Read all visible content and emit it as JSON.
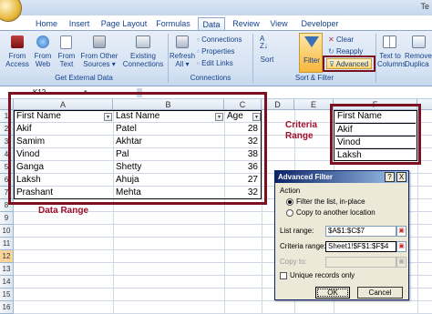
{
  "window": {
    "title": "Te"
  },
  "tabs": [
    "Home",
    "Insert",
    "Page Layout",
    "Formulas",
    "Data",
    "Review",
    "View",
    "Developer"
  ],
  "active_tab": "Data",
  "ribbon": {
    "get_external": {
      "buttons": [
        {
          "l1": "From",
          "l2": "Access"
        },
        {
          "l1": "From",
          "l2": "Web"
        },
        {
          "l1": "From",
          "l2": "Text"
        },
        {
          "l1": "From Other",
          "l2": "Sources ▾"
        },
        {
          "l1": "Existing",
          "l2": "Connections"
        }
      ],
      "label": "Get External Data"
    },
    "connections": {
      "refresh": {
        "l1": "Refresh",
        "l2": "All ▾"
      },
      "items": [
        "Connections",
        "Properties",
        "Edit Links"
      ],
      "label": "Connections"
    },
    "sort_filter": {
      "sort": "Sort",
      "filter": "Filter",
      "items": [
        "Clear",
        "Reapply",
        "Advanced"
      ],
      "label": "Sort & Filter"
    },
    "data_tools": {
      "text_to_columns": {
        "l1": "Text to",
        "l2": "Columns"
      },
      "remove_dup": {
        "l1": "Remove",
        "l2": "Duplica"
      }
    }
  },
  "name_box": "K12",
  "columns": [
    "A",
    "B",
    "C",
    "D",
    "E",
    "F"
  ],
  "rows": [
    "1",
    "2",
    "3",
    "4",
    "5",
    "6",
    "7",
    "8",
    "9",
    "10",
    "11",
    "12",
    "13",
    "14",
    "15",
    "16"
  ],
  "data_range": {
    "headers": [
      "First Name",
      "Last Name",
      "Age"
    ],
    "rows": [
      [
        "Akif",
        "Patel",
        "28"
      ],
      [
        "Samim",
        "Akhtar",
        "32"
      ],
      [
        "Vinod",
        "Pal",
        "38"
      ],
      [
        "Ganga",
        "Shetty",
        "36"
      ],
      [
        "Laksh",
        "Ahuja",
        "27"
      ],
      [
        "Prashant",
        "Mehta",
        "32"
      ]
    ],
    "label": "Data Range"
  },
  "criteria_range": {
    "label_line1": "Criteria",
    "label_line2": "Range",
    "header": "First Name",
    "values": [
      "Akif",
      "Vinod",
      "Laksh"
    ]
  },
  "dialog": {
    "title": "Advanced Filter",
    "help": "?",
    "close": "X",
    "action_label": "Action",
    "option1": "Filter the list, in-place",
    "option2": "Copy to another location",
    "selected_option": "option1",
    "list_range_label": "List range:",
    "list_range_value": "$A$1:$C$7",
    "criteria_range_label": "Criteria range:",
    "criteria_range_value": "Sheet1!$F$1:$F$4",
    "copy_to_label": "Copy to:",
    "copy_to_value": "",
    "unique_label": "Unique records only",
    "unique_checked": false,
    "ok": "OK",
    "cancel": "Cancel"
  },
  "colors": {
    "accent": "#7a1020",
    "ribbon_text": "#15428b",
    "selected_row": "#f8d49a"
  }
}
